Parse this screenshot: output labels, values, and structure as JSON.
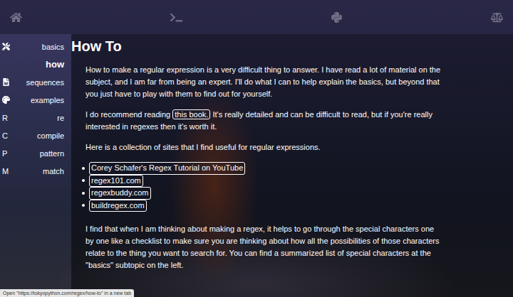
{
  "sidebar": {
    "items": [
      {
        "label": "basics",
        "kind": "icon",
        "glyph": "",
        "selected": false
      },
      {
        "label": "how",
        "kind": "icon",
        "glyph": "",
        "selected": true
      },
      {
        "label": "sequences",
        "kind": "icon",
        "glyph": "",
        "selected": false
      },
      {
        "label": "examples",
        "kind": "icon",
        "glyph": "",
        "selected": false
      },
      {
        "label": "re",
        "kind": "letter",
        "glyph": "R",
        "selected": false
      },
      {
        "label": "compile",
        "kind": "letter",
        "glyph": "C",
        "selected": false
      },
      {
        "label": "pattern",
        "kind": "letter",
        "glyph": "P",
        "selected": false
      },
      {
        "label": "match",
        "kind": "letter",
        "glyph": "M",
        "selected": false
      }
    ]
  },
  "page": {
    "title": "How To",
    "paragraphs": [
      {
        "segments": [
          {
            "text": "How to make a regular expression is a very difficult thing to answer. I have read a lot of material on the subject, and I am far from being an expert. I'll do what I can to help explain the basics, but beyond that you just have to play with them to find out for yourself.",
            "link": false
          }
        ]
      },
      {
        "segments": [
          {
            "text": "I do recommend reading ",
            "link": false
          },
          {
            "text": "this book.",
            "link": true
          },
          {
            "text": " It's really detailed and can be difficult to read, but if you're really interested in regexes then it's worth it.",
            "link": false
          }
        ]
      },
      {
        "segments": [
          {
            "text": "Here is a collection of sites that I find useful for regular expressions.",
            "link": false
          }
        ]
      }
    ],
    "links": [
      "Corey Schafer's Regex Tutorial on YouTube",
      "regex101.com",
      "regexbuddy.com",
      "buildregex.com"
    ],
    "closing": "I find that when I am thinking about making a regex, it helps to go through the special characters one by one like a checklist to make sure you are thinking about how all the possibilities of those characters relate to the thing you want to search for. You can find a summarized list of special characters at the \"basics\" subtopic on the left."
  },
  "status_bar": "Open \"https://tokyopython.com/regex/how-to\" in a new tab"
}
